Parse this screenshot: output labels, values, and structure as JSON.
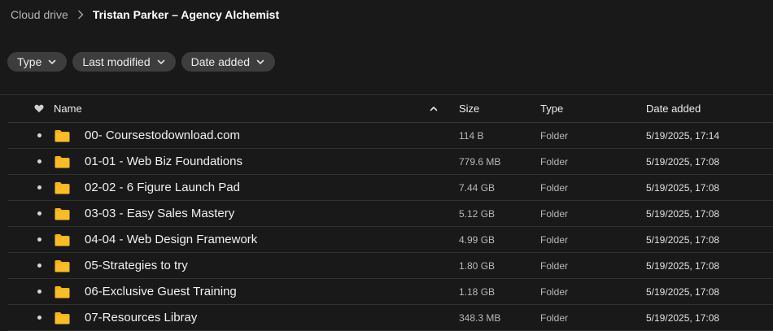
{
  "breadcrumb": {
    "root": "Cloud drive",
    "current": "Tristan Parker – Agency Alchemist"
  },
  "filters": [
    {
      "label": "Type"
    },
    {
      "label": "Last modified"
    },
    {
      "label": "Date added"
    }
  ],
  "table": {
    "headers": {
      "name": "Name",
      "size": "Size",
      "type": "Type",
      "date": "Date added"
    },
    "sort": {
      "column": "name",
      "direction": "ascending"
    },
    "rows": [
      {
        "name": "00- Coursestodownload.com",
        "size": "114 B",
        "type": "Folder",
        "date": "5/19/2025, 17:14"
      },
      {
        "name": "01-01 - Web Biz Foundations",
        "size": "779.6 MB",
        "type": "Folder",
        "date": "5/19/2025, 17:08"
      },
      {
        "name": "02-02 - 6 Figure Launch Pad",
        "size": "7.44 GB",
        "type": "Folder",
        "date": "5/19/2025, 17:08"
      },
      {
        "name": "03-03 - Easy Sales Mastery",
        "size": "5.12 GB",
        "type": "Folder",
        "date": "5/19/2025, 17:08"
      },
      {
        "name": "04-04 - Web Design Framework",
        "size": "4.99 GB",
        "type": "Folder",
        "date": "5/19/2025, 17:08"
      },
      {
        "name": "05-Strategies to try",
        "size": "1.80 GB",
        "type": "Folder",
        "date": "5/19/2025, 17:08"
      },
      {
        "name": "06-Exclusive Guest Training",
        "size": "1.18 GB",
        "type": "Folder",
        "date": "5/19/2025, 17:08"
      },
      {
        "name": "07-Resources Libray",
        "size": "348.3 MB",
        "type": "Folder",
        "date": "5/19/2025, 17:08"
      }
    ]
  },
  "icons": {
    "chevron": "chevron-right-icon",
    "dropdown": "chevron-down-icon",
    "favourite": "heart-icon",
    "sort": "sort-ascending-icon",
    "folder": "folder-icon"
  },
  "colors": {
    "background": "#191919",
    "chip": "#3d3d3d",
    "folder": "#f5b21b"
  }
}
